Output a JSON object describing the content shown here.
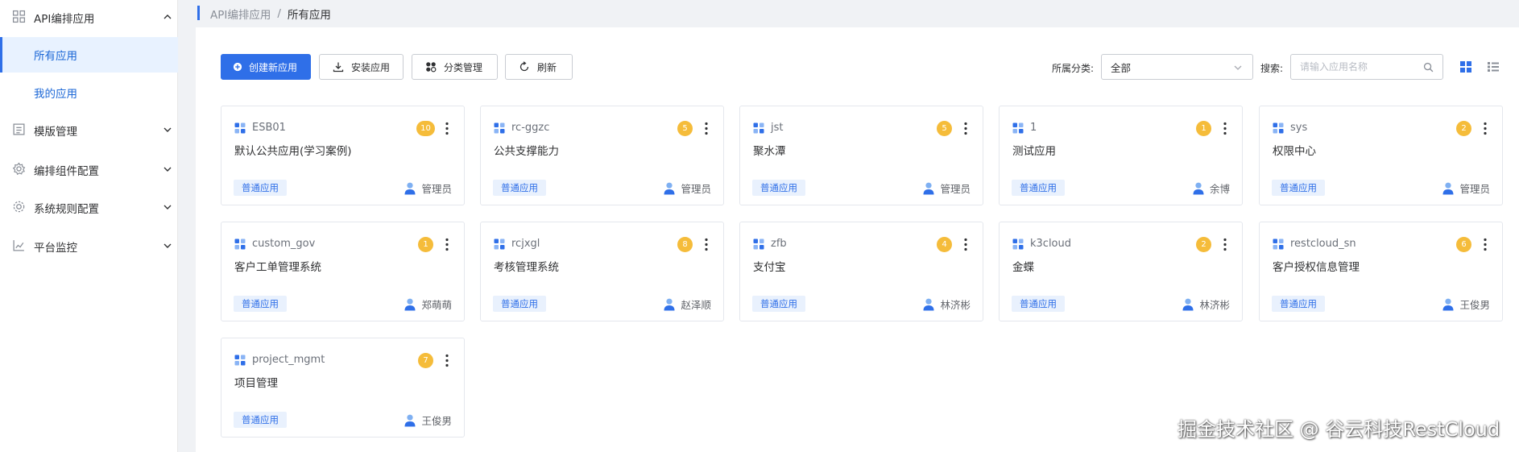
{
  "sidebar": {
    "items": [
      {
        "label": "API编排应用",
        "icon": "grid-icon",
        "expanded": true
      },
      {
        "label": "所有应用",
        "active": true
      },
      {
        "label": "我的应用"
      },
      {
        "label": "模版管理",
        "icon": "template-icon"
      },
      {
        "label": "编排组件配置",
        "icon": "gear-icon"
      },
      {
        "label": "系统规则配置",
        "icon": "cog-icon"
      },
      {
        "label": "平台监控",
        "icon": "chart-icon"
      }
    ]
  },
  "breadcrumb": {
    "parent": "API编排应用",
    "separator": "/",
    "current": "所有应用"
  },
  "toolbar": {
    "create_label": "创建新应用",
    "install_label": "安装应用",
    "category_label": "分类管理",
    "refresh_label": "刷新",
    "category_filter_label": "所属分类:",
    "category_filter_value": "全部",
    "search_label": "搜索:",
    "search_placeholder": "请输入应用名称"
  },
  "cards": [
    {
      "code": "ESB01",
      "title": "默认公共应用(学习案例)",
      "count": "10",
      "tag": "普通应用",
      "owner": "管理员"
    },
    {
      "code": "rc-ggzc",
      "title": "公共支撑能力",
      "count": "5",
      "tag": "普通应用",
      "owner": "管理员"
    },
    {
      "code": "jst",
      "title": "聚水潭",
      "count": "5",
      "tag": "普通应用",
      "owner": "管理员"
    },
    {
      "code": "1",
      "title": "测试应用",
      "count": "1",
      "tag": "普通应用",
      "owner": "余博"
    },
    {
      "code": "sys",
      "title": "权限中心",
      "count": "2",
      "tag": "普通应用",
      "owner": "管理员"
    },
    {
      "code": "custom_gov",
      "title": "客户工单管理系统",
      "count": "1",
      "tag": "普通应用",
      "owner": "郑萌萌"
    },
    {
      "code": "rcjxgl",
      "title": "考核管理系统",
      "count": "8",
      "tag": "普通应用",
      "owner": "赵泽顺"
    },
    {
      "code": "zfb",
      "title": "支付宝",
      "count": "4",
      "tag": "普通应用",
      "owner": "林济彬"
    },
    {
      "code": "k3cloud",
      "title": "金蝶",
      "count": "2",
      "tag": "普通应用",
      "owner": "林济彬"
    },
    {
      "code": "restcloud_sn",
      "title": "客户授权信息管理",
      "count": "6",
      "tag": "普通应用",
      "owner": "王俊男"
    },
    {
      "code": "project_mgmt",
      "title": "项目管理",
      "count": "7",
      "tag": "普通应用",
      "owner": "王俊男"
    }
  ],
  "watermark": "掘金技术社区 @ 谷云科技RestCloud",
  "colors": {
    "primary": "#2f6fe8",
    "badge": "#f5bc3a",
    "tag_bg": "#e9f1fd",
    "active_bg": "#e8f2ff"
  }
}
